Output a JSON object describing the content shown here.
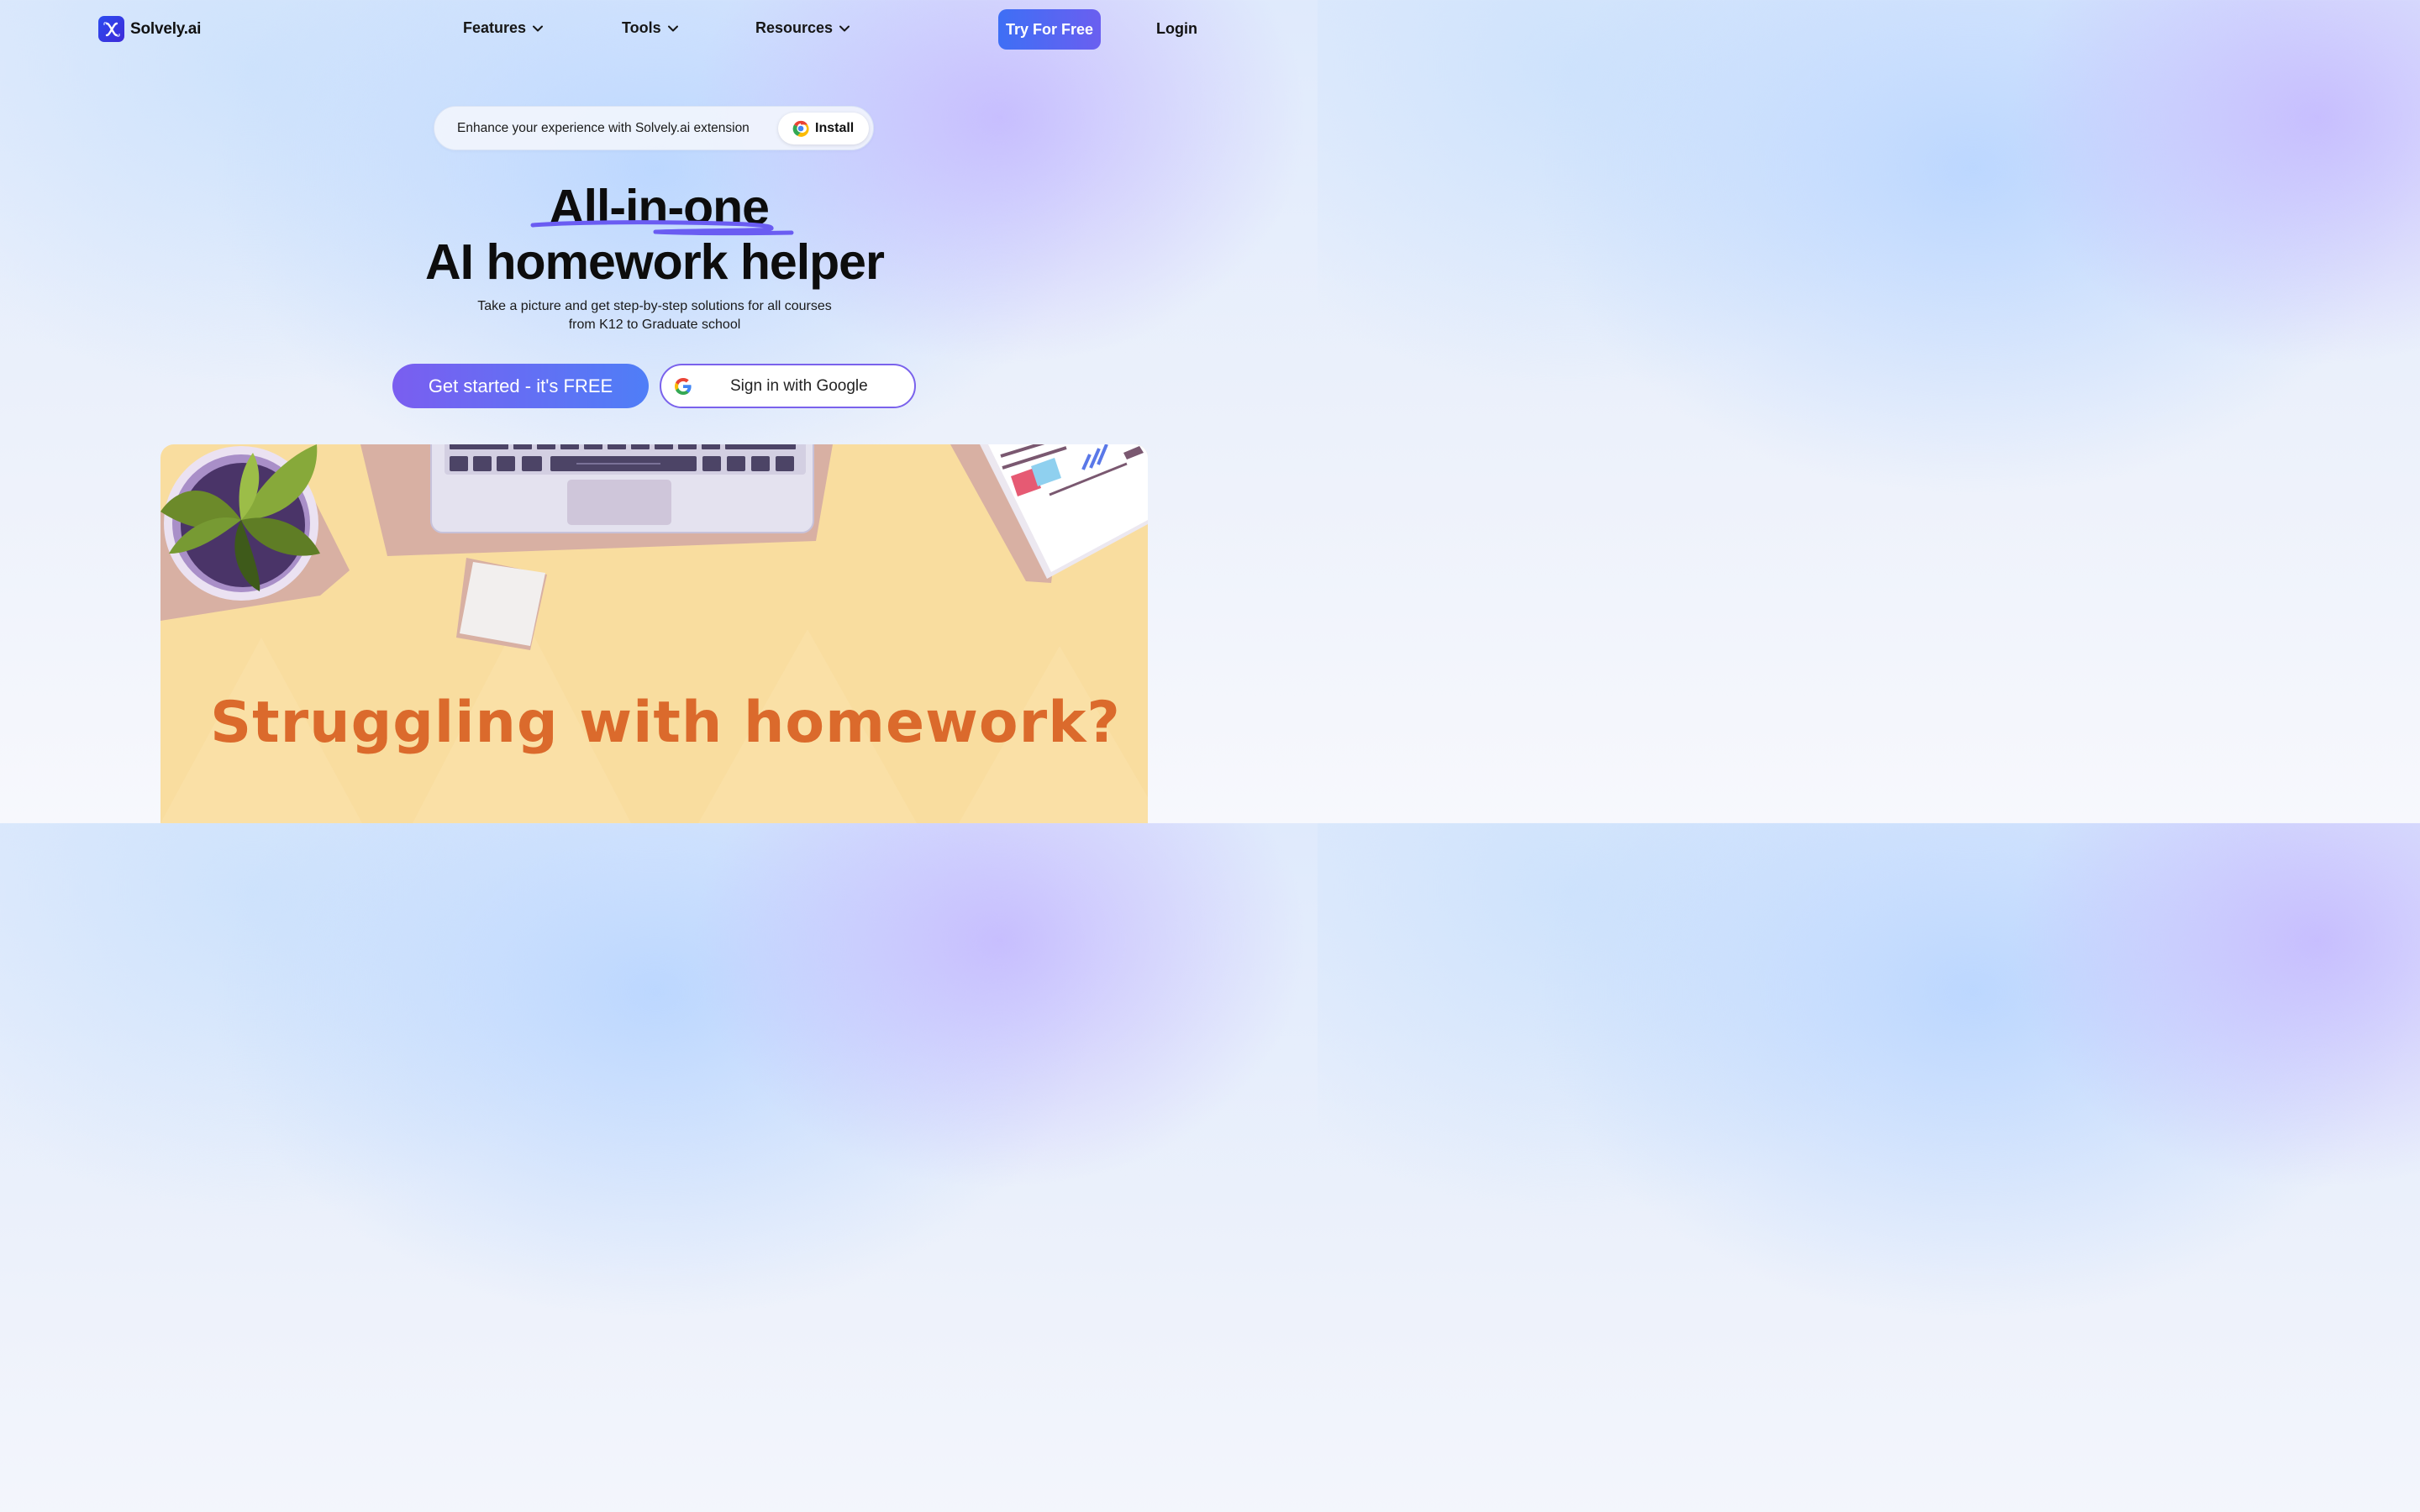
{
  "nav": {
    "logo_text": "Solvely.ai",
    "items": [
      {
        "label": "Features"
      },
      {
        "label": "Tools"
      },
      {
        "label": "Resources"
      }
    ],
    "try_label": "Try For Free",
    "login_label": "Login"
  },
  "extension": {
    "text": "Enhance your experience with Solvely.ai extension",
    "install_label": "Install"
  },
  "hero": {
    "line1": "All-in-one",
    "line2": "AI homework helper",
    "subtitle_line1": "Take a picture and get step-by-step solutions for all courses",
    "subtitle_line2": "from K12 to Graduate school",
    "cta_label": "Get started - it's FREE",
    "google_label": "Sign in with Google"
  },
  "illustration": {
    "title": "Struggling with homework?"
  },
  "colors": {
    "brand_blue": "#3e6ff5",
    "brand_purple": "#7a5ef0",
    "illustration_bg": "#f9dd9f",
    "illustration_title": "#db6a2c"
  },
  "icons": {
    "logo": "x-logo-icon",
    "chevrons": "chevron-down-icon",
    "chrome": "chrome-icon",
    "google": "google-g-icon"
  }
}
